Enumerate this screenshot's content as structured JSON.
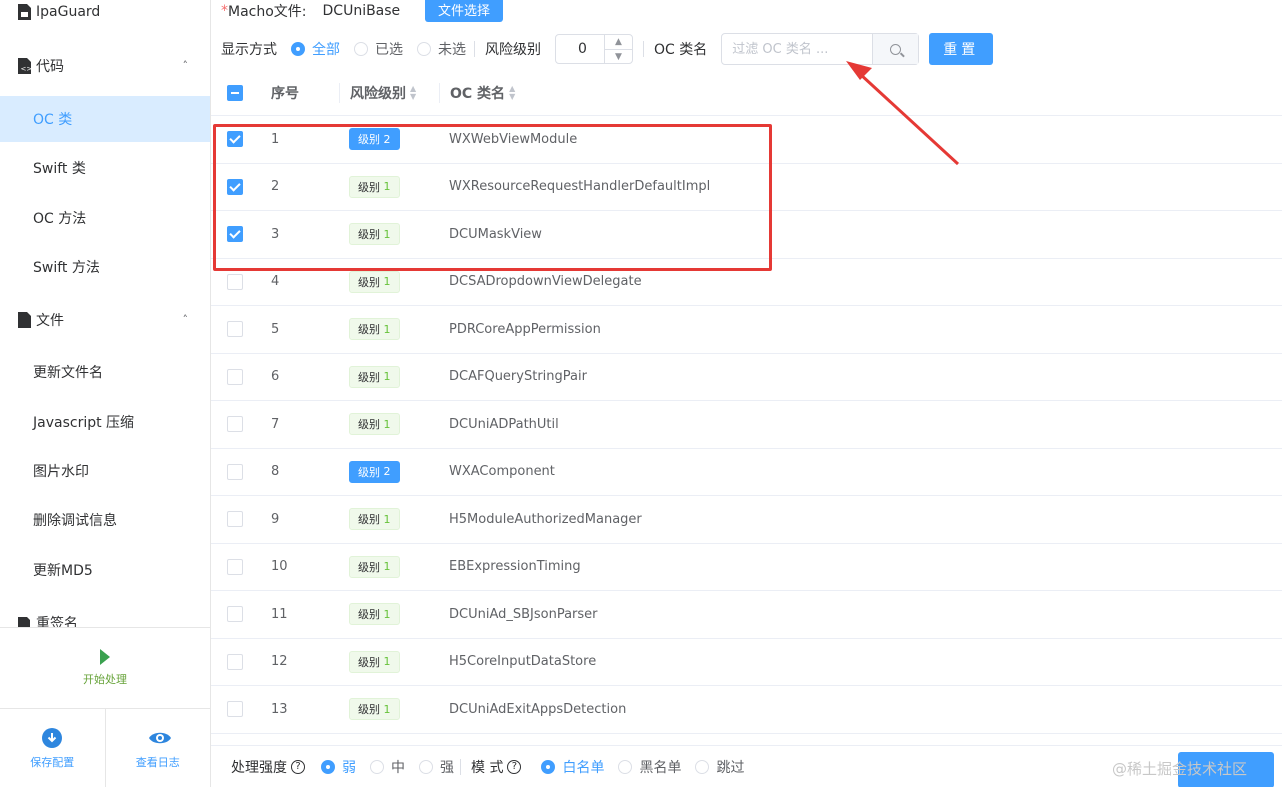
{
  "sidebar": {
    "app_title": "IpaGuard",
    "code_group": "代码",
    "code_items": [
      "OC 类",
      "Swift 类",
      "OC 方法",
      "Swift 方法"
    ],
    "file_group": "文件",
    "file_items": [
      "更新文件名",
      "Javascript 压缩",
      "图片水印",
      "删除调试信息",
      "更新MD5"
    ],
    "resign_group": "重签名",
    "start_label": "开始处理",
    "save_label": "保存配置",
    "log_label": "查看日志"
  },
  "top": {
    "macho_label": "Macho文件:",
    "macho_value": "DCUniBase",
    "file_button": "文件选择"
  },
  "toolbar": {
    "display_label": "显示方式",
    "display_options": [
      "全部",
      "已选",
      "未选"
    ],
    "display_selected": "全部",
    "risk_label": "风险级别",
    "risk_value": "0",
    "oc_label": "OC 类名",
    "search_placeholder": "过滤 OC 类名 ...",
    "reset_label": "重置"
  },
  "table": {
    "headers": [
      "序号",
      "风险级别",
      "OC 类名"
    ],
    "level_prefix": "级别",
    "rows": [
      {
        "no": "1",
        "level": "2",
        "name": "WXWebViewModule",
        "checked": true
      },
      {
        "no": "2",
        "level": "1",
        "name": "WXResourceRequestHandlerDefaultImpl",
        "checked": true
      },
      {
        "no": "3",
        "level": "1",
        "name": "DCUMaskView",
        "checked": true
      },
      {
        "no": "4",
        "level": "1",
        "name": "DCSADropdownViewDelegate",
        "checked": false
      },
      {
        "no": "5",
        "level": "1",
        "name": "PDRCoreAppPermission",
        "checked": false
      },
      {
        "no": "6",
        "level": "1",
        "name": "DCAFQueryStringPair",
        "checked": false
      },
      {
        "no": "7",
        "level": "1",
        "name": "DCUniADPathUtil",
        "checked": false
      },
      {
        "no": "8",
        "level": "2",
        "name": "WXAComponent",
        "checked": false
      },
      {
        "no": "9",
        "level": "1",
        "name": "H5ModuleAuthorizedManager",
        "checked": false
      },
      {
        "no": "10",
        "level": "1",
        "name": "EBExpressionTiming",
        "checked": false
      },
      {
        "no": "11",
        "level": "1",
        "name": "DCUniAd_SBJsonParser",
        "checked": false
      },
      {
        "no": "12",
        "level": "1",
        "name": "H5CoreInputDataStore",
        "checked": false
      },
      {
        "no": "13",
        "level": "1",
        "name": "DCUniAdExitAppsDetection",
        "checked": false
      }
    ]
  },
  "footer": {
    "strength_label": "处理强度",
    "strength_options": [
      "弱",
      "中",
      "强"
    ],
    "strength_selected": "弱",
    "mode_label": "模 式",
    "mode_options": [
      "白名单",
      "黑名单",
      "跳过"
    ],
    "mode_selected": "白名单"
  },
  "watermark": "@稀土掘金技术社区",
  "colors": {
    "primary": "#409eff",
    "annotation": "#e53935",
    "level1": "#67c23a"
  }
}
